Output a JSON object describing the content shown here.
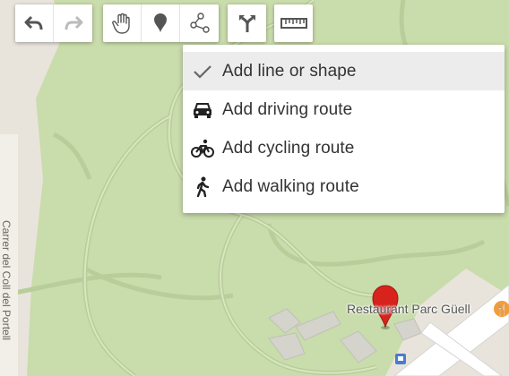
{
  "toolbar": {
    "undo_icon": "undo-icon",
    "redo_icon": "redo-icon",
    "pan_icon": "hand-icon",
    "marker_icon": "marker-icon",
    "line_icon": "draw-line-icon",
    "route_icon": "route-icon",
    "measure_icon": "ruler-icon"
  },
  "menu": {
    "items": [
      {
        "label": "Add line or shape",
        "icon": "checkmark-icon",
        "selected": true
      },
      {
        "label": "Add driving route",
        "icon": "car-icon"
      },
      {
        "label": "Add cycling route",
        "icon": "bicycle-icon"
      },
      {
        "label": "Add walking route",
        "icon": "walking-icon"
      }
    ]
  },
  "map": {
    "poi_label": "Restaurant Parc Güell",
    "street_label": "Carrer del Coll del Portell",
    "colors": {
      "park": "#c8dcaa",
      "land": "#e8e4dc",
      "road": "#ffffff",
      "marker": "#d8231c"
    }
  }
}
